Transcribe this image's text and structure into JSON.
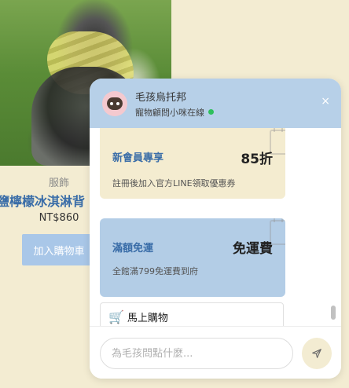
{
  "product": {
    "category": "服飾",
    "name": "鹽檸檬冰淇淋背",
    "price": "NT$860",
    "add_to_cart": "加入購物車"
  },
  "chat": {
    "title": "毛孩烏托邦",
    "subtitle": "寵物顧問小咪在線",
    "close": "×",
    "promos": [
      {
        "title": "新會員專享",
        "value": "85折",
        "desc": "註冊後加入官方LINE領取優惠券",
        "color": "#f4ecd0"
      },
      {
        "title": "滿額免運",
        "value": "免運費",
        "desc": "全館滿799免運費到府",
        "color": "#b3cde6"
      }
    ],
    "shop_now": "馬上購物",
    "input_placeholder": "為毛孩問點什麼...",
    "online_color": "#2ec05c",
    "accent": "#3a6da8",
    "header_color": "#b7d0e8"
  },
  "icons": {
    "avatar": "puppy-avatar-icon",
    "cart": "shopping-cart-icon",
    "send": "send-icon",
    "close": "close-icon"
  }
}
